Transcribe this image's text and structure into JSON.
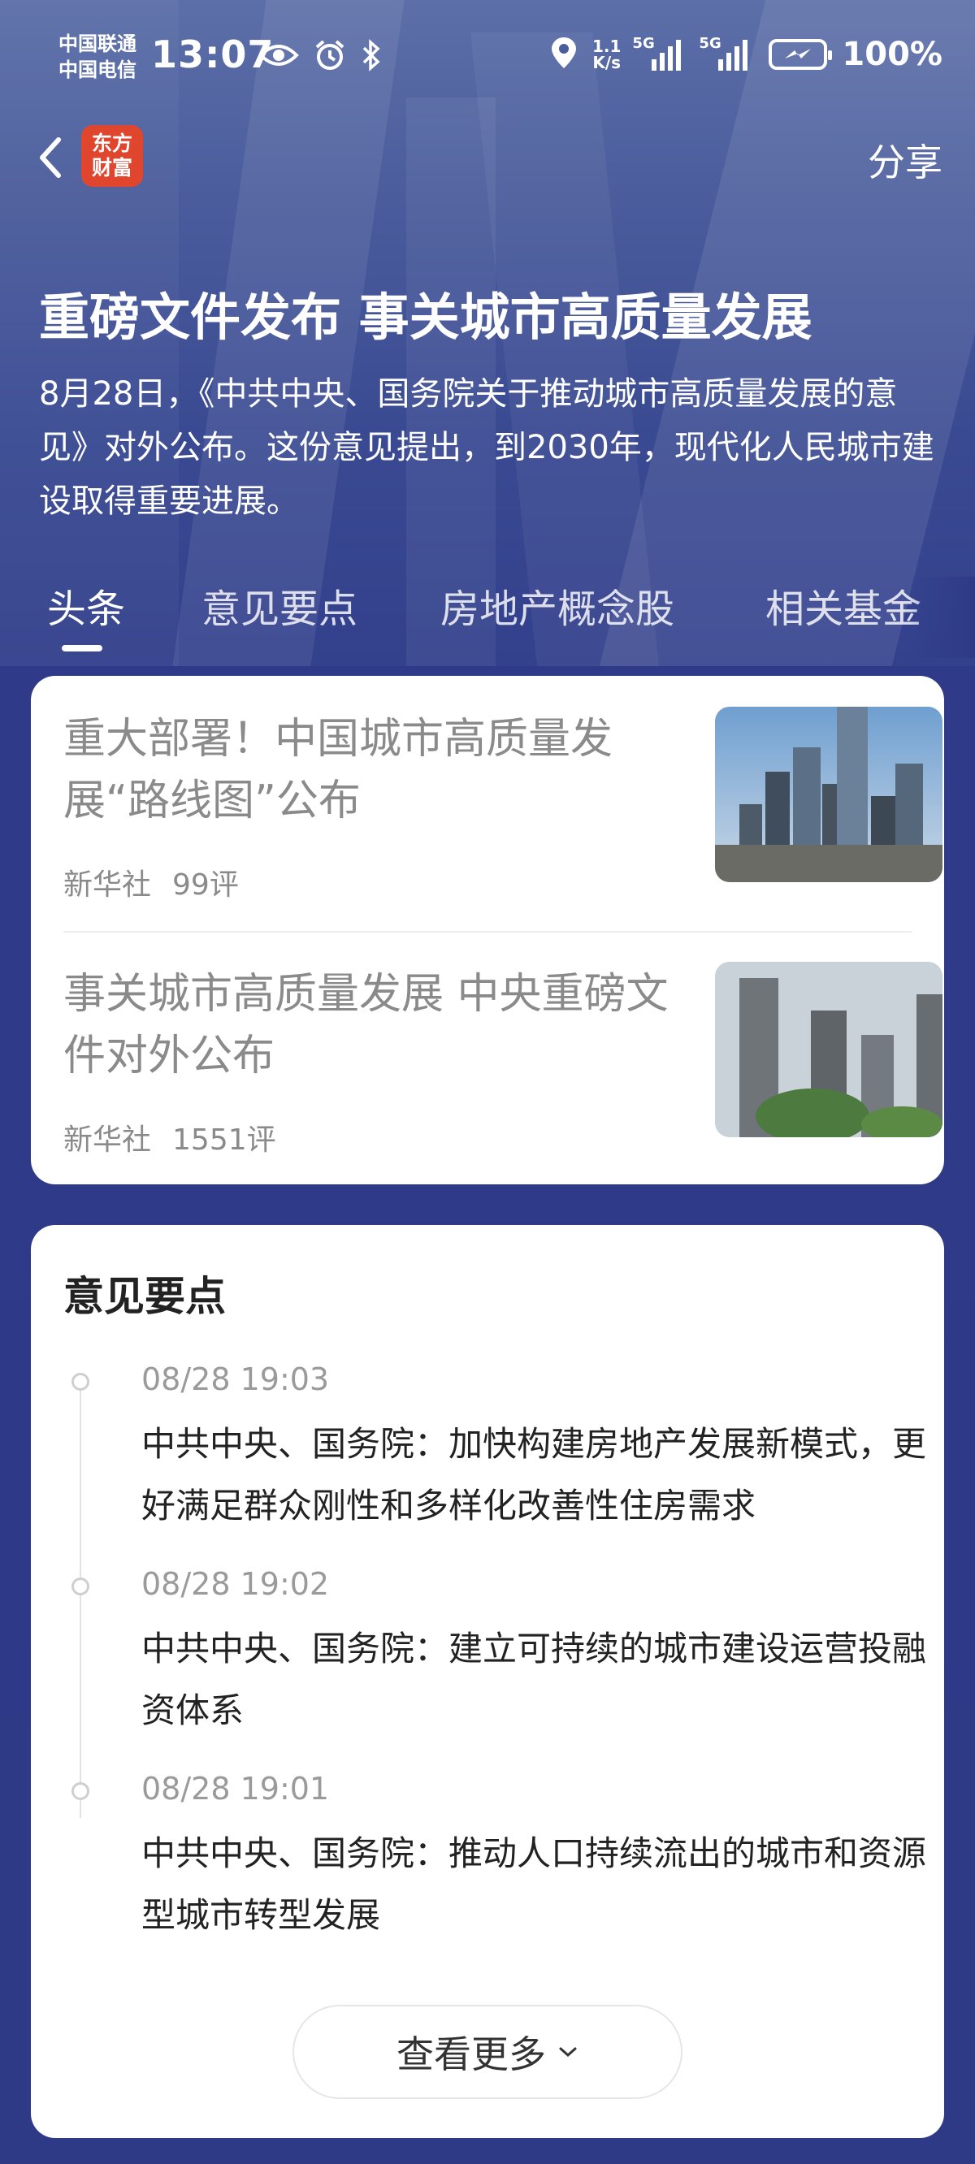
{
  "status_bar": {
    "carrier_1": "中国联通",
    "carrier_2": "中国电信",
    "time": "13:07",
    "net_speed_value": "1.1",
    "net_speed_unit": "K/s",
    "sim1_label": "5G",
    "sim2_label": "5G",
    "battery": "100%",
    "icons": [
      "eye-icon",
      "alarm-icon",
      "bluetooth-icon",
      "location-icon",
      "signal-icon",
      "battery-charging-icon"
    ]
  },
  "nav": {
    "logo_text_line1": "东方",
    "logo_text_line2": "财富",
    "share_label": "分享",
    "back_icon": "chevron-left-icon"
  },
  "header": {
    "title": "重磅文件发布 事关城市高质量发展",
    "summary": "8月28日，《中共中央、国务院关于推动城市高质量发展的意见》对外公布。这份意见提出，到2030年，现代化人民城市建设取得重要进展。"
  },
  "tabs": [
    {
      "label": "头条",
      "active": true
    },
    {
      "label": "意见要点",
      "active": false
    },
    {
      "label": "房地产概念股",
      "active": false
    },
    {
      "label": "相关基金",
      "active": false
    }
  ],
  "news": [
    {
      "headline": "重大部署！中国城市高质量发展“路线图”公布",
      "source": "新华社",
      "comments": "99评"
    },
    {
      "headline": "事关城市高质量发展 中央重磅文件对外公布",
      "source": "新华社",
      "comments": "1551评"
    }
  ],
  "points": {
    "title": "意见要点",
    "items": [
      {
        "time": "08/28 19:03",
        "text": "中共中央、国务院：加快构建房地产发展新模式，更好满足群众刚性和多样化改善性住房需求"
      },
      {
        "time": "08/28 19:02",
        "text": "中共中央、国务院：建立可持续的城市建设运营投融资体系"
      },
      {
        "time": "08/28 19:01",
        "text": "中共中央、国务院：推动人口持续流出的城市和资源型城市转型发展"
      }
    ],
    "more_label": "查看更多"
  },
  "colors": {
    "page_bg": "#2e3a86",
    "logo_bg": "#e0452e",
    "card_bg": "#ffffff",
    "muted_text": "#8a8a8a"
  }
}
